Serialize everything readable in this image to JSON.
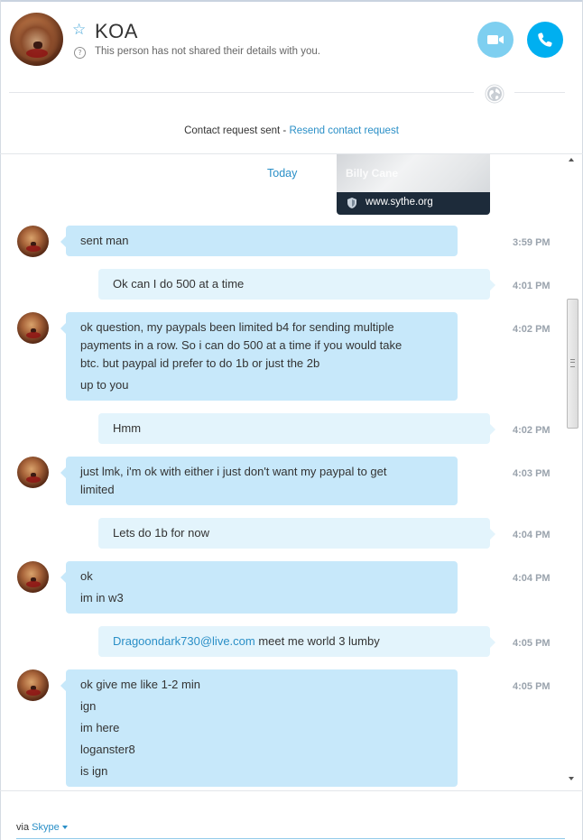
{
  "header": {
    "contact_name": "KOA",
    "details_note": "This person has not shared their details with you."
  },
  "request": {
    "status_text": "Contact request sent - ",
    "resend_label": "Resend contact request"
  },
  "link_preview": {
    "title": "Billy Cane",
    "url": "www.sythe.org"
  },
  "chat": {
    "date_label": "Today",
    "messages": [
      {
        "direction": "in",
        "time": "3:59 PM",
        "lines": [
          "sent man"
        ]
      },
      {
        "direction": "out",
        "time": "4:01 PM",
        "lines": [
          "Ok can I do 500 at a time"
        ]
      },
      {
        "direction": "in",
        "time": "4:02 PM",
        "lines": [
          "ok question, my paypals been limited b4 for sending multiple",
          "payments in a row. So i can do 500 at a time if you would take",
          "btc. but paypal id prefer to do 1b or just the 2b",
          "up to you"
        ]
      },
      {
        "direction": "out",
        "time": "4:02 PM",
        "lines": [
          "Hmm"
        ]
      },
      {
        "direction": "in",
        "time": "4:03 PM",
        "lines": [
          "just lmk, i'm ok with either i just don't want my paypal to get",
          "limited"
        ]
      },
      {
        "direction": "out",
        "time": "4:04 PM",
        "lines": [
          "Lets do 1b for now"
        ]
      },
      {
        "direction": "in",
        "time": "4:04 PM",
        "lines": [
          "ok",
          "im in w3"
        ]
      },
      {
        "direction": "out",
        "time": "4:05 PM",
        "email": "Dragoondark730@live.com",
        "text": " meet me world 3 lumby"
      },
      {
        "direction": "in",
        "time": "4:05 PM",
        "lines": [
          "ok give me like 1-2 min",
          "ign",
          "im here",
          "loganster8",
          "is ign"
        ]
      }
    ]
  },
  "footer": {
    "via_label": "via",
    "service_label": "Skype"
  },
  "colors": {
    "accent": "#00aff0",
    "video_button": "#7ecff0",
    "incoming_bubble": "#c7e8fa",
    "outgoing_bubble": "#e3f4fc",
    "link": "#2a8fc7"
  },
  "icons": [
    "star-icon",
    "info-icon",
    "video-camera-icon",
    "phone-icon",
    "globe-icon",
    "shield-icon",
    "chevron-down-icon"
  ]
}
